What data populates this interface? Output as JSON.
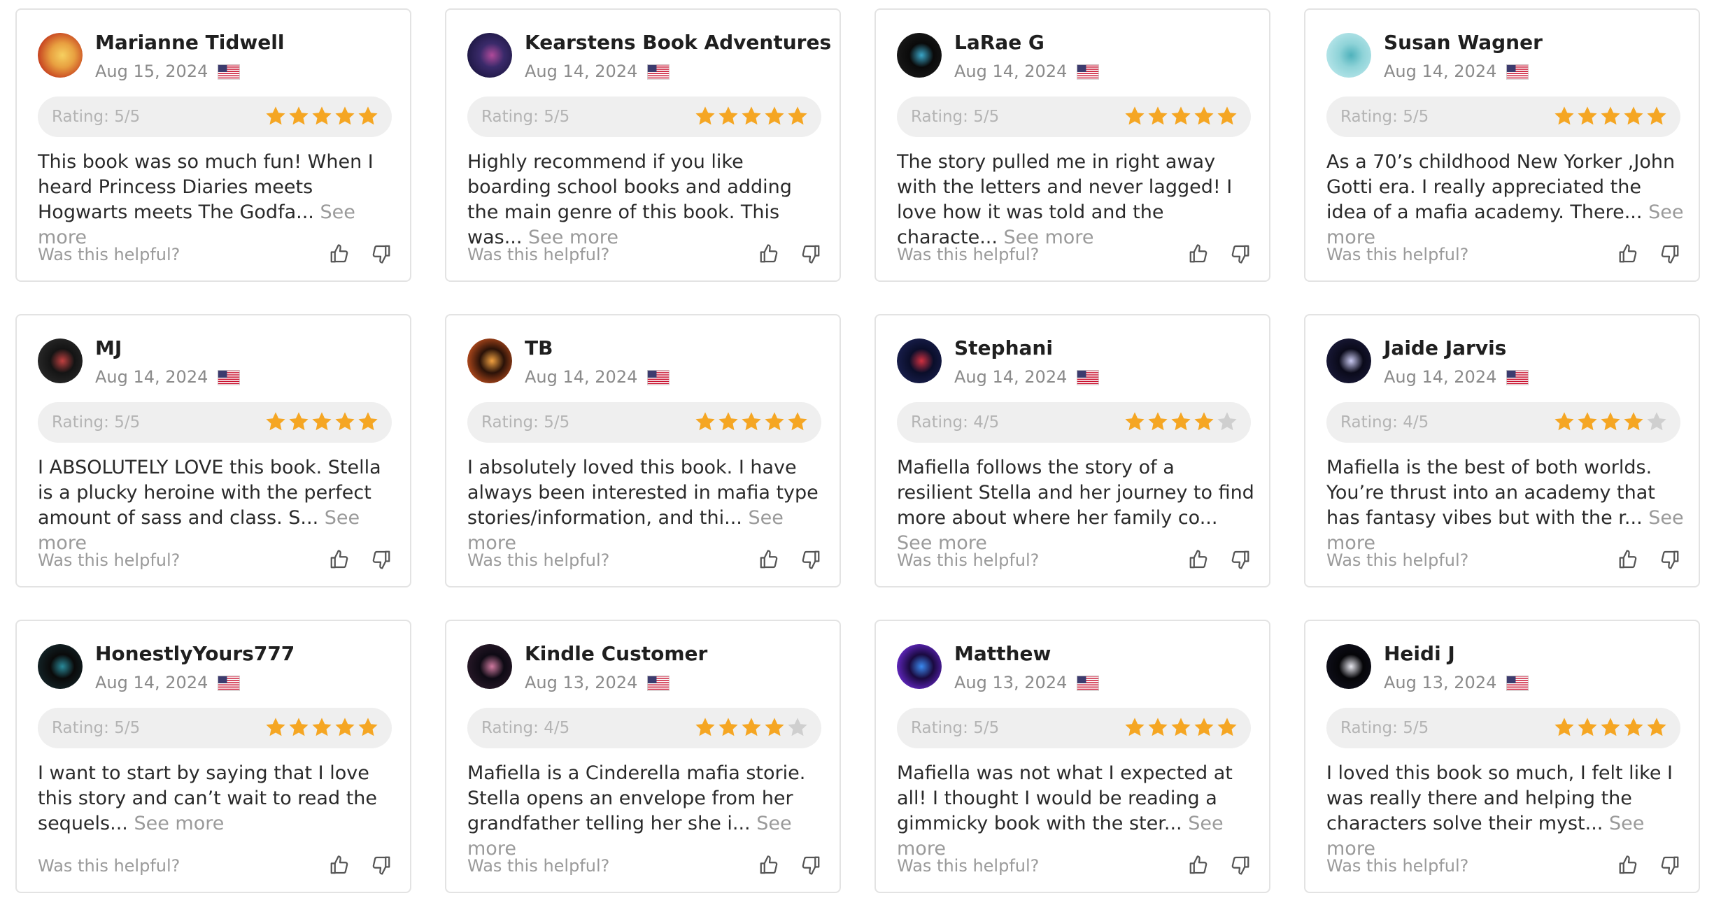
{
  "ui": {
    "rating_prefix": "Rating: ",
    "helpful_label": "Was this helpful?",
    "see_more_label": "See more",
    "flag_icon": "us-flag-icon",
    "thumb_up_icon": "thumbs-up-icon",
    "thumb_down_icon": "thumbs-down-icon",
    "colors": {
      "star_filled": "#f5a623",
      "star_empty": "#cfcfcf",
      "rating_bg": "#efefef",
      "border": "#e3e3e3",
      "muted_text": "#9a9a9a"
    }
  },
  "reviews": [
    {
      "name": "Marianne Tidwell",
      "date": "Aug 15, 2024",
      "rating_text": "Rating: 5/5",
      "stars": 5,
      "text": "This book was so much fun! When I heard Princess Diaries meets Hogwarts meets The Godfa...",
      "avatar_colors": [
        "#e8a040",
        "#c0301a",
        "#f6d060"
      ]
    },
    {
      "name": "Kearstens Book Adventures",
      "date": "Aug 14, 2024",
      "rating_text": "Rating: 5/5",
      "stars": 5,
      "text": "Highly recommend if you like boarding school books and adding the main genre of this book. This was...",
      "avatar_colors": [
        "#3a2a6a",
        "#1b1640",
        "#b04a9a"
      ]
    },
    {
      "name": "LaRae G",
      "date": "Aug 14, 2024",
      "rating_text": "Rating: 5/5",
      "stars": 5,
      "text": "The story pulled me in right away with the letters and never lagged! I love how it was told and the characte...",
      "avatar_colors": [
        "#0a0a0a",
        "#1a1a1a",
        "#3aa6c8"
      ]
    },
    {
      "name": "Susan Wagner",
      "date": "Aug 14, 2024",
      "rating_text": "Rating: 5/5",
      "stars": 5,
      "text": "As a 70’s childhood New Yorker ,John Gotti era. I really appreciated the idea of a mafia academy. There...",
      "avatar_colors": [
        "#8fd3d8",
        "#b8e6ea",
        "#4fb2bc"
      ]
    },
    {
      "name": "MJ",
      "date": "Aug 14, 2024",
      "rating_text": "Rating: 5/5",
      "stars": 5,
      "text": "I ABSOLUTELY LOVE this book. Stella is a plucky heroine with the perfect amount of sass and class. S...",
      "avatar_colors": [
        "#141414",
        "#2a2a2a",
        "#c04040"
      ]
    },
    {
      "name": "TB",
      "date": "Aug 14, 2024",
      "rating_text": "Rating: 5/5",
      "stars": 5,
      "text": "I absolutely loved this book. I have always been interested in mafia type stories/information, and thi...",
      "avatar_colors": [
        "#2a1208",
        "#c2501e",
        "#f0a040"
      ]
    },
    {
      "name": "Stephani",
      "date": "Aug 14, 2024",
      "rating_text": "Rating: 4/5",
      "stars": 4,
      "text": "Mafiella follows the story of a resilient Stella and her journey to find more about where her family co...",
      "avatar_colors": [
        "#0a0e2a",
        "#1a2050",
        "#d03040"
      ]
    },
    {
      "name": "Jaide Jarvis",
      "date": "Aug 14, 2024",
      "rating_text": "Rating: 4/5",
      "stars": 4,
      "text": "Mafiella is the best of both worlds. You’re thrust into an academy that has fantasy vibes but with the r...",
      "avatar_colors": [
        "#0a0a1a",
        "#1a1a3a",
        "#c8c8f0"
      ]
    },
    {
      "name": "HonestlyYours777",
      "date": "Aug 14, 2024",
      "rating_text": "Rating: 5/5",
      "stars": 5,
      "text": "I want to start by saying that I love this story and can’t wait to read the sequels...",
      "avatar_colors": [
        "#0a0a0a",
        "#14262a",
        "#2a8a9a"
      ]
    },
    {
      "name": "Kindle Customer",
      "date": "Aug 13, 2024",
      "rating_text": "Rating: 4/5",
      "stars": 4,
      "text": "Mafiella is a Cinderella mafia storie. Stella opens an envelope from her grandfather telling her she i...",
      "avatar_colors": [
        "#0e0a14",
        "#2a1a2a",
        "#d07aa0"
      ]
    },
    {
      "name": "Matthew",
      "date": "Aug 13, 2024",
      "rating_text": "Rating: 5/5",
      "stars": 5,
      "text": "Mafiella was not what I expected at all! I thought I would be reading a gimmicky book with the ster...",
      "avatar_colors": [
        "#1a0a40",
        "#6a2ad0",
        "#3a8af0"
      ]
    },
    {
      "name": "Heidi J",
      "date": "Aug 13, 2024",
      "rating_text": "Rating: 5/5",
      "stars": 5,
      "text": "I loved this book so much, I felt like I was really there and helping the characters solve their myst...",
      "avatar_colors": [
        "#050508",
        "#10101c",
        "#e8e8f0"
      ]
    }
  ]
}
